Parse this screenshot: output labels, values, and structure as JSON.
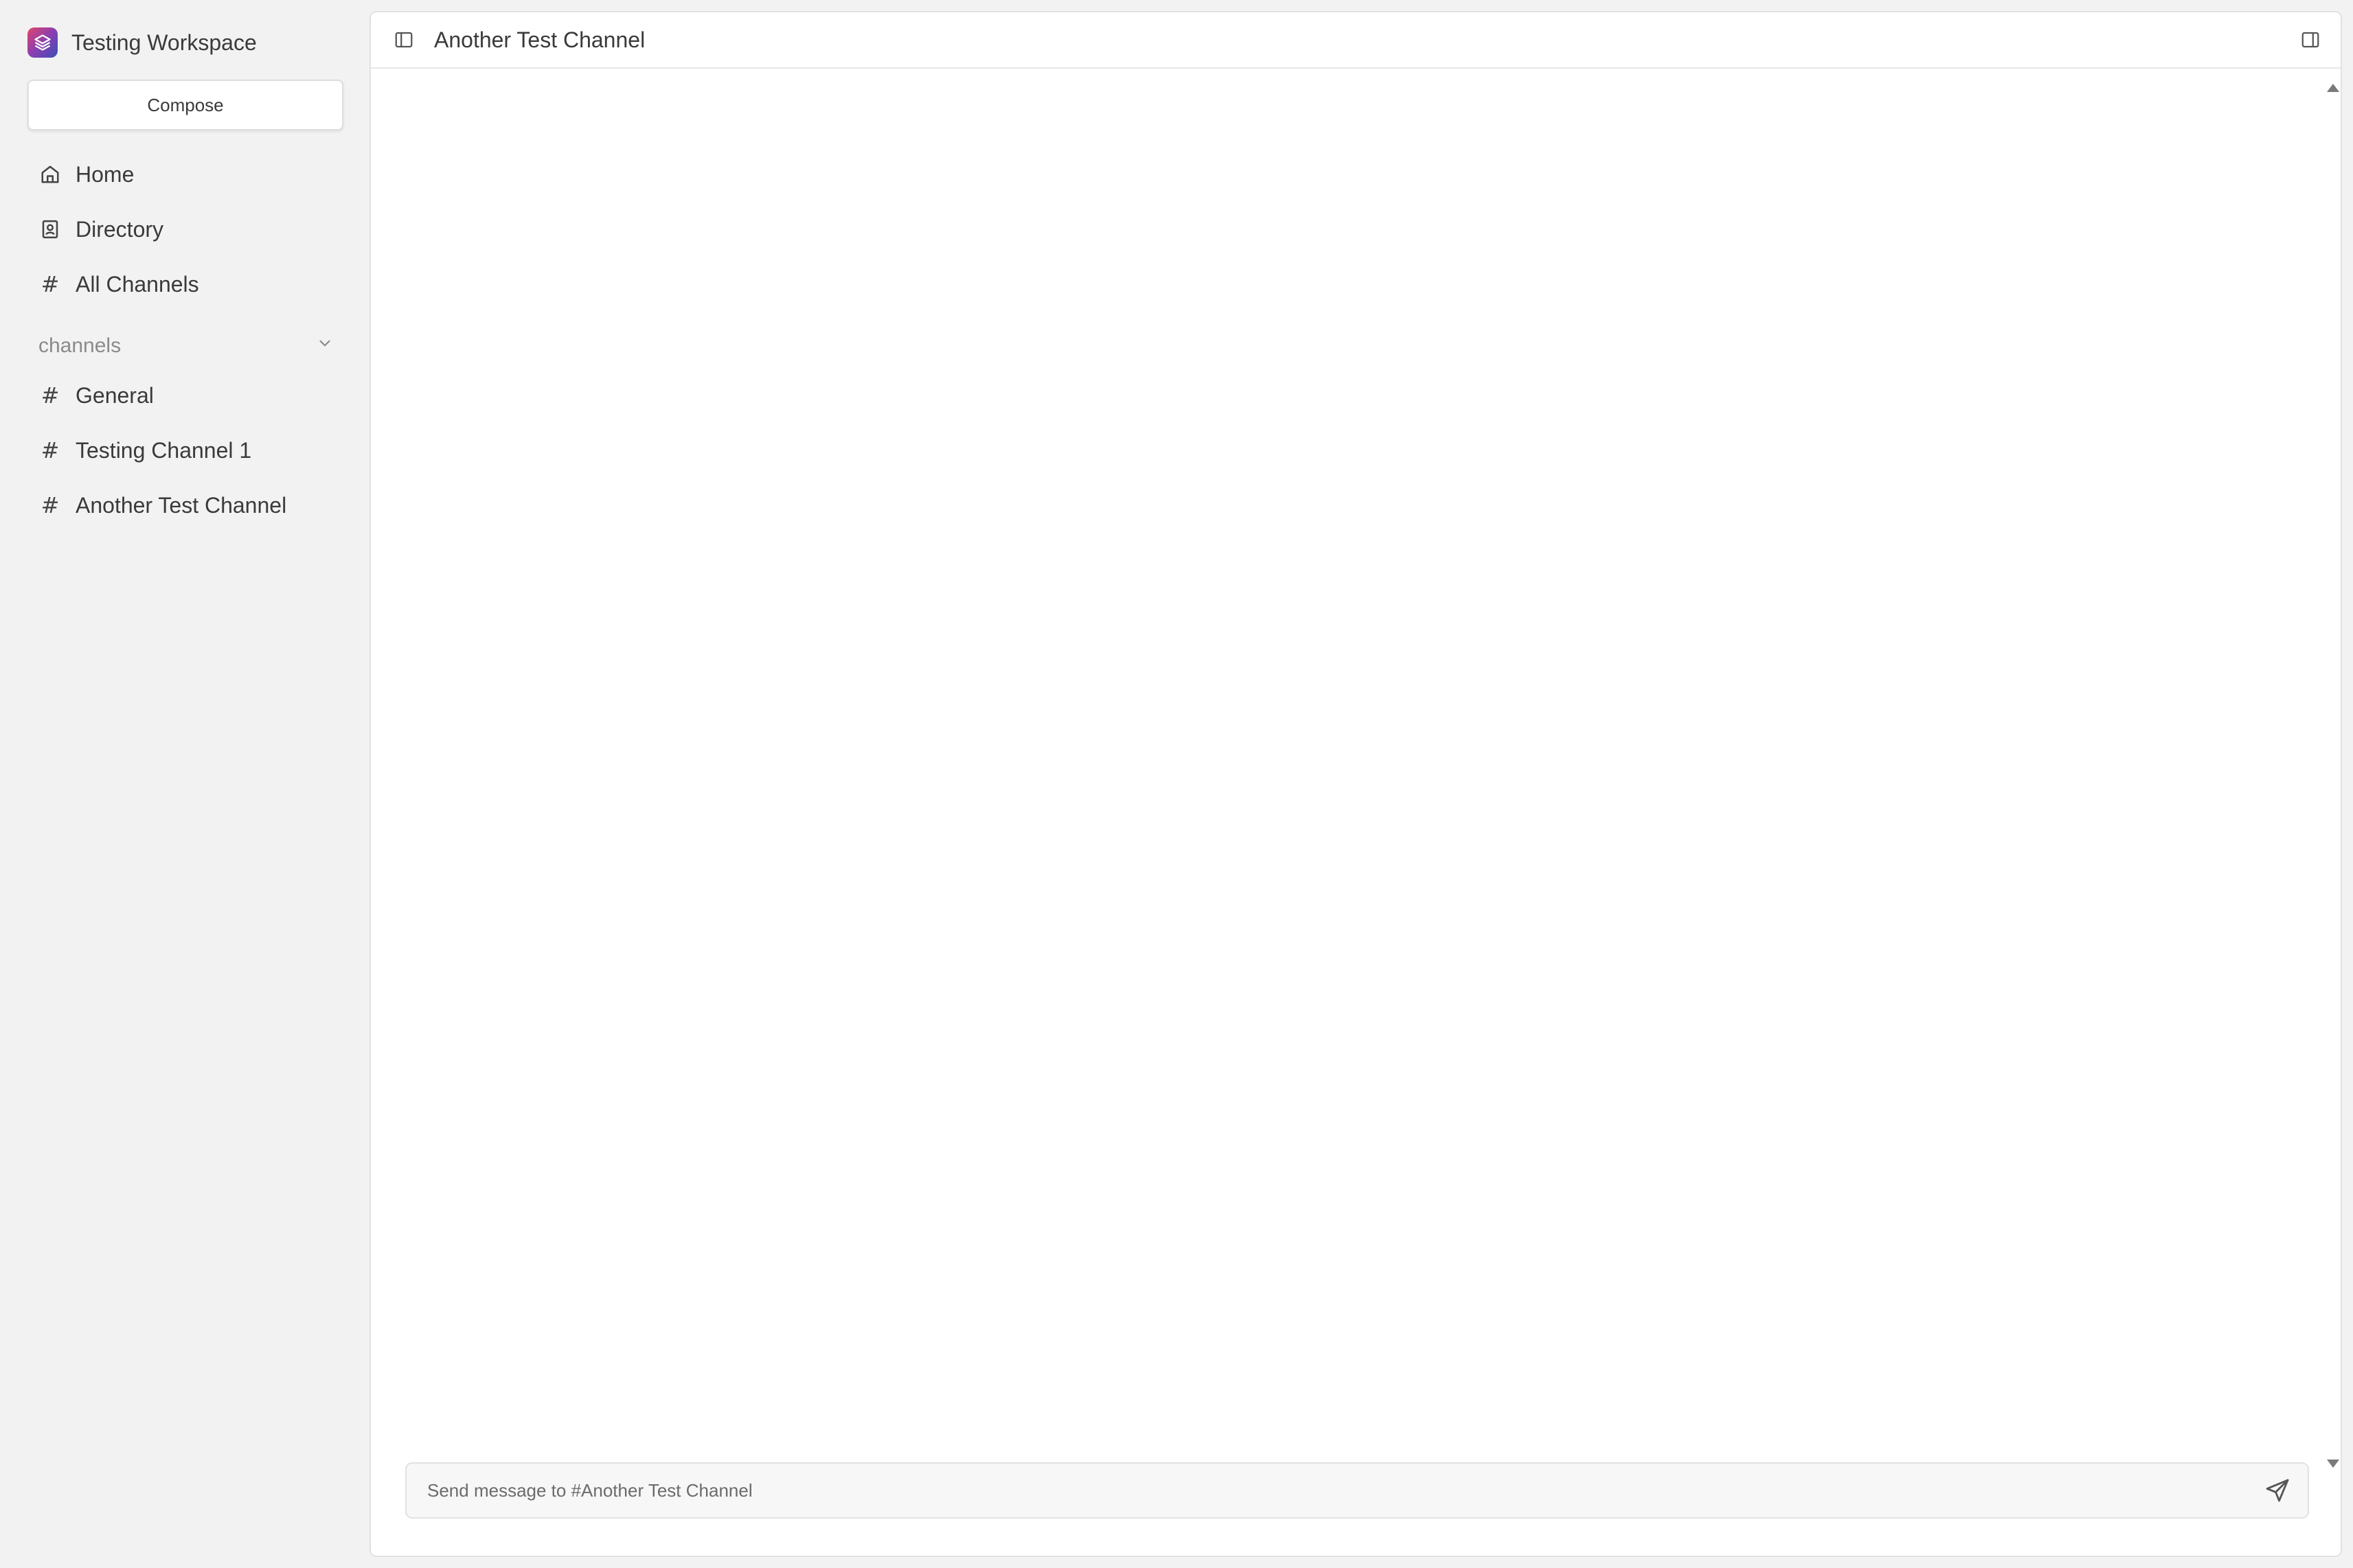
{
  "workspace": {
    "name": "Testing Workspace",
    "logo_icon": "layers-icon",
    "logo_colors": [
      "#e0456b",
      "#8a3fb0",
      "#3b4fb8"
    ]
  },
  "sidebar": {
    "compose_label": "Compose",
    "nav": [
      {
        "label": "Home",
        "icon": "home-icon"
      },
      {
        "label": "Directory",
        "icon": "contact-book-icon"
      },
      {
        "label": "All Channels",
        "icon": "hash-icon"
      }
    ],
    "section": {
      "label": "channels",
      "icon": "chevron-down-icon"
    },
    "channels": [
      {
        "label": "General"
      },
      {
        "label": "Testing Channel 1"
      },
      {
        "label": "Another Test Channel"
      }
    ]
  },
  "main": {
    "title": "Another Test Channel",
    "left_toggle_icon": "sidebar-left-icon",
    "right_toggle_icon": "sidebar-right-icon",
    "composer": {
      "placeholder": "Send message to #Another Test Channel",
      "send_icon": "send-icon"
    }
  }
}
